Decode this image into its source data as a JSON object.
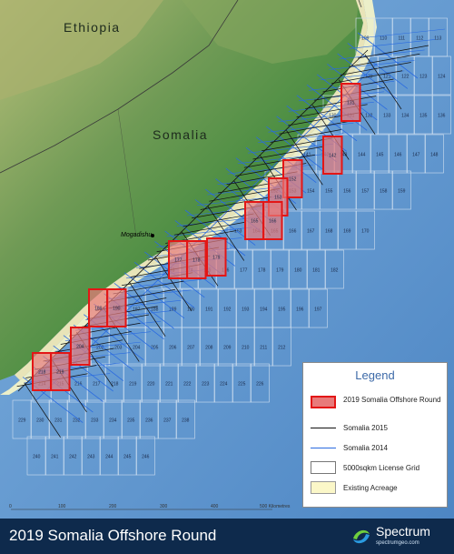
{
  "map": {
    "countries": [
      {
        "name": "Ethiopia"
      },
      {
        "name": "Somalia"
      }
    ],
    "city": "Mogadishu",
    "scale_labels": [
      "0",
      "100",
      "200",
      "300",
      "400",
      "500 Kilometres"
    ],
    "blocks_2019": [
      "131",
      "142",
      "152",
      "153",
      "165",
      "166",
      "177",
      "178",
      "179",
      "189",
      "190",
      "204",
      "218",
      "219"
    ],
    "colors": {
      "ocean": "#6a9cd0",
      "grid_line": "#cfdff0",
      "existing_acreage": "#fbf7c8",
      "block_fill": "#e87a7a",
      "block_border": "#e31616",
      "somalia_2015": "#111111",
      "somalia_2014": "#2a6be0",
      "footer": "#0e2a4c"
    }
  },
  "legend": {
    "title": "Legend",
    "items": [
      {
        "label": "2019 Somalia Offshore Round",
        "icon": "red-block-swatch"
      },
      {
        "label": "Somalia 2015",
        "icon": "black-line-swatch"
      },
      {
        "label": "Somalia 2014",
        "icon": "blue-line-swatch"
      },
      {
        "label": "5000sqkm License Grid",
        "icon": "white-box-swatch"
      },
      {
        "label": "Existing Acreage",
        "icon": "yellow-box-swatch"
      }
    ]
  },
  "footer": {
    "title": "2019 Somalia Offshore Round",
    "brand_name": "Spectrum",
    "brand_url": "spectrumgeo.com"
  }
}
